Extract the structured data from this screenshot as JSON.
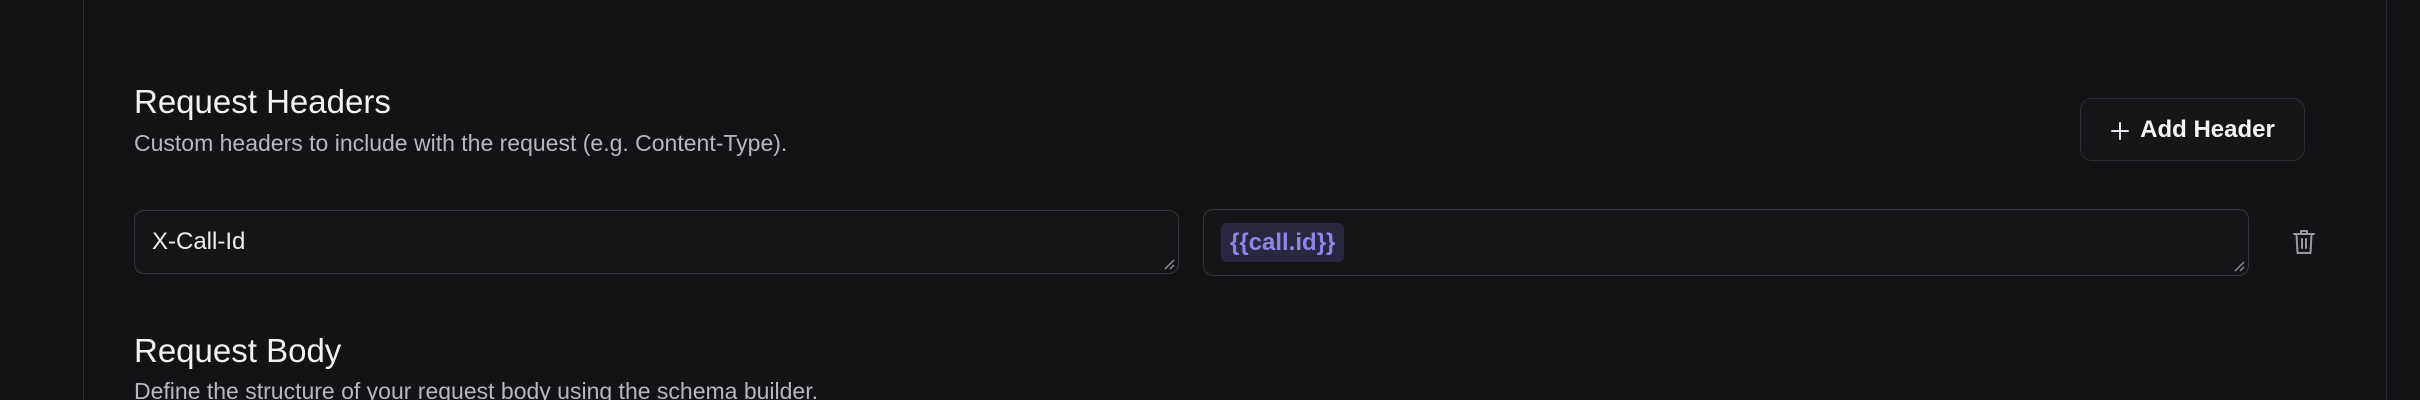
{
  "headers_section": {
    "title": "Request Headers",
    "description": "Custom headers to include with the request (e.g. Content-Type).",
    "add_button_label": "Add Header",
    "rows": [
      {
        "key": "X-Call-Id",
        "value": "{{call.id}}"
      }
    ]
  },
  "body_section": {
    "title": "Request Body",
    "description": "Define the structure of your request body using the schema builder."
  },
  "icons": {
    "add": "plus-icon",
    "delete": "trash-icon",
    "resize": "resize-handle-icon"
  },
  "colors": {
    "background": "#131315",
    "token_text": "#8f85e6",
    "token_background": "#2a2740"
  }
}
